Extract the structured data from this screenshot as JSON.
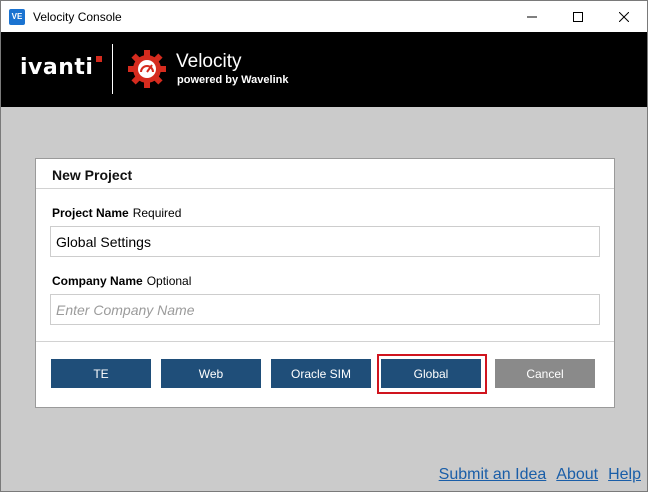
{
  "window": {
    "title": "Velocity Console",
    "app_icon_text": "VE"
  },
  "banner": {
    "brand": "ivanti",
    "product": "Velocity",
    "tagline": "powered by Wavelink"
  },
  "dialog": {
    "title": "New Project",
    "project_name": {
      "label": "Project Name",
      "hint": "Required",
      "value": "Global Settings"
    },
    "company_name": {
      "label": "Company Name",
      "hint": "Optional",
      "placeholder": "Enter Company Name"
    },
    "buttons": {
      "te": "TE",
      "web": "Web",
      "oracle_sim": "Oracle SIM",
      "global": "Global",
      "cancel": "Cancel"
    }
  },
  "footer": {
    "submit_idea": "Submit an Idea",
    "about": "About",
    "help": "Help"
  },
  "colors": {
    "primary_button": "#1f4e79",
    "cancel_button": "#8a8a8a",
    "highlight": "#d0141e",
    "link": "#1a5ea8"
  }
}
